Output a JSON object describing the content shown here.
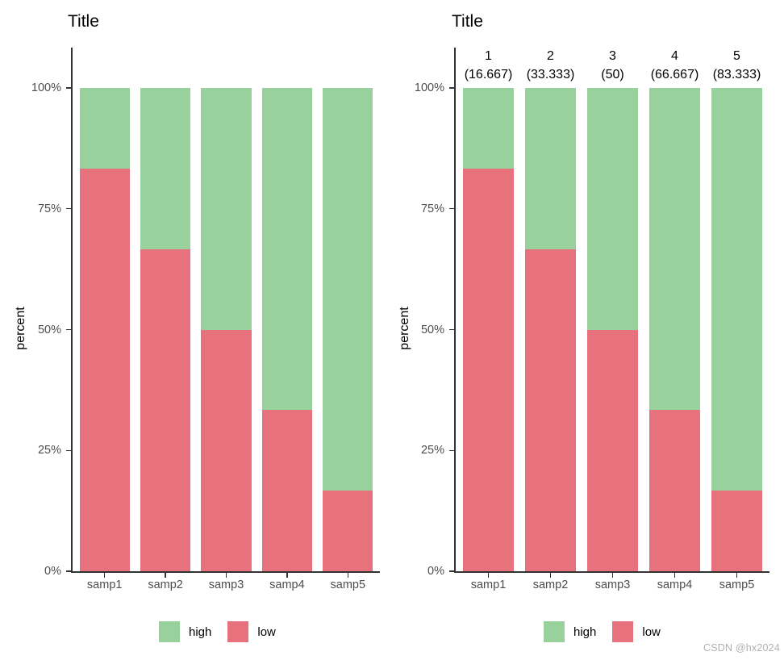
{
  "watermark": "CSDN @hx2024",
  "colors": {
    "high": "#99d19c",
    "low": "#e8717e",
    "axis": "#333333",
    "tick_text": "#4d4d4d",
    "title_text": "#000000",
    "background": "#ffffff",
    "watermark_text": "#b0b0b0"
  },
  "panels": [
    {
      "id": "left",
      "title": "Title",
      "has_column_annotations": false
    },
    {
      "id": "right",
      "title": "Title",
      "has_column_annotations": true
    }
  ],
  "legend": {
    "items": [
      {
        "label": "high",
        "color": "#99d19c"
      },
      {
        "label": "low",
        "color": "#e8717e"
      }
    ]
  },
  "chart_data": [
    {
      "type": "bar",
      "subtype": "stacked-percent",
      "panel": "left",
      "title": "Title",
      "xlabel": "",
      "ylabel": "percent",
      "categories": [
        "samp1",
        "samp2",
        "samp3",
        "samp4",
        "samp5"
      ],
      "ytick_labels": [
        "0%",
        "25%",
        "50%",
        "75%",
        "100%"
      ],
      "ytick_values": [
        0,
        25,
        50,
        75,
        100
      ],
      "ylim": [
        0,
        100
      ],
      "grid": false,
      "legend_position": "bottom",
      "series": [
        {
          "name": "low",
          "color": "#e8717e",
          "values": [
            83.333,
            66.667,
            50,
            33.333,
            16.667
          ]
        },
        {
          "name": "high",
          "color": "#99d19c",
          "values": [
            16.667,
            33.333,
            50,
            66.667,
            83.333
          ]
        }
      ]
    },
    {
      "type": "bar",
      "subtype": "stacked-percent",
      "panel": "right",
      "title": "Title",
      "xlabel": "",
      "ylabel": "percent",
      "categories": [
        "samp1",
        "samp2",
        "samp3",
        "samp4",
        "samp5"
      ],
      "ytick_labels": [
        "0%",
        "25%",
        "50%",
        "75%",
        "100%"
      ],
      "ytick_values": [
        0,
        25,
        50,
        75,
        100
      ],
      "ylim": [
        0,
        100
      ],
      "grid": false,
      "legend_position": "bottom",
      "annotations": [
        {
          "rank": "1",
          "value": "(16.667)"
        },
        {
          "rank": "2",
          "value": "(33.333)"
        },
        {
          "rank": "3",
          "value": "(50)"
        },
        {
          "rank": "4",
          "value": "(66.667)"
        },
        {
          "rank": "5",
          "value": "(83.333)"
        }
      ],
      "series": [
        {
          "name": "low",
          "color": "#e8717e",
          "values": [
            83.333,
            66.667,
            50,
            33.333,
            16.667
          ]
        },
        {
          "name": "high",
          "color": "#99d19c",
          "values": [
            16.667,
            33.333,
            50,
            66.667,
            83.333
          ]
        }
      ]
    }
  ]
}
